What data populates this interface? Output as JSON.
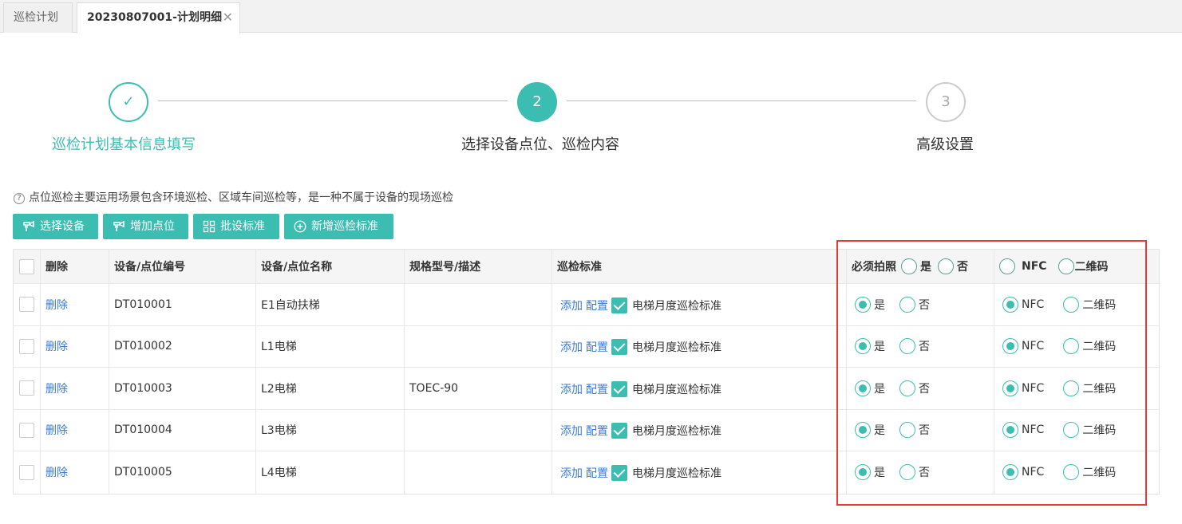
{
  "tabs": [
    {
      "label": "巡检计划"
    },
    {
      "label": "20230807001-计划明细",
      "close": "✕"
    }
  ],
  "steps": [
    {
      "label": "巡检计划基本信息填写",
      "mark": "✓"
    },
    {
      "label": "选择设备点位、巡检内容",
      "mark": "2"
    },
    {
      "label": "高级设置",
      "mark": "3"
    }
  ],
  "hint": {
    "icon": "?",
    "text": "点位巡检主要运用场景包含环境巡检、区域车间巡检等，是一种不属于设备的现场巡检"
  },
  "toolbar": {
    "select_device": "选择设备",
    "add_point": "增加点位",
    "batch_standard": "批设标准",
    "new_standard": "新增巡检标准"
  },
  "table": {
    "headers": {
      "delete": "删除",
      "code": "设备/点位编号",
      "name": "设备/点位名称",
      "spec": "规格型号/描述",
      "standard": "巡检标准",
      "photo": "必须拍照",
      "yes": "是",
      "no": "否",
      "nfc": "NFC",
      "qr": "二维码"
    },
    "row_labels": {
      "delete": "删除",
      "add": "添加",
      "config": "配置",
      "yes": "是",
      "no": "否",
      "nfc": "NFC",
      "qr": "二维码"
    },
    "rows": [
      {
        "code": "DT010001",
        "name": "E1自动扶梯",
        "spec": "",
        "standard": "电梯月度巡检标准"
      },
      {
        "code": "DT010002",
        "name": "L1电梯",
        "spec": "",
        "standard": "电梯月度巡检标准"
      },
      {
        "code": "DT010003",
        "name": "L2电梯",
        "spec": "TOEC-90",
        "standard": "电梯月度巡检标准"
      },
      {
        "code": "DT010004",
        "name": "L3电梯",
        "spec": "",
        "standard": "电梯月度巡检标准"
      },
      {
        "code": "DT010005",
        "name": "L4电梯",
        "spec": "",
        "standard": "电梯月度巡检标准"
      }
    ]
  },
  "colors": {
    "accent": "#3cbdb1",
    "link": "#3a7bd5",
    "highlight": "#e23b3b"
  }
}
